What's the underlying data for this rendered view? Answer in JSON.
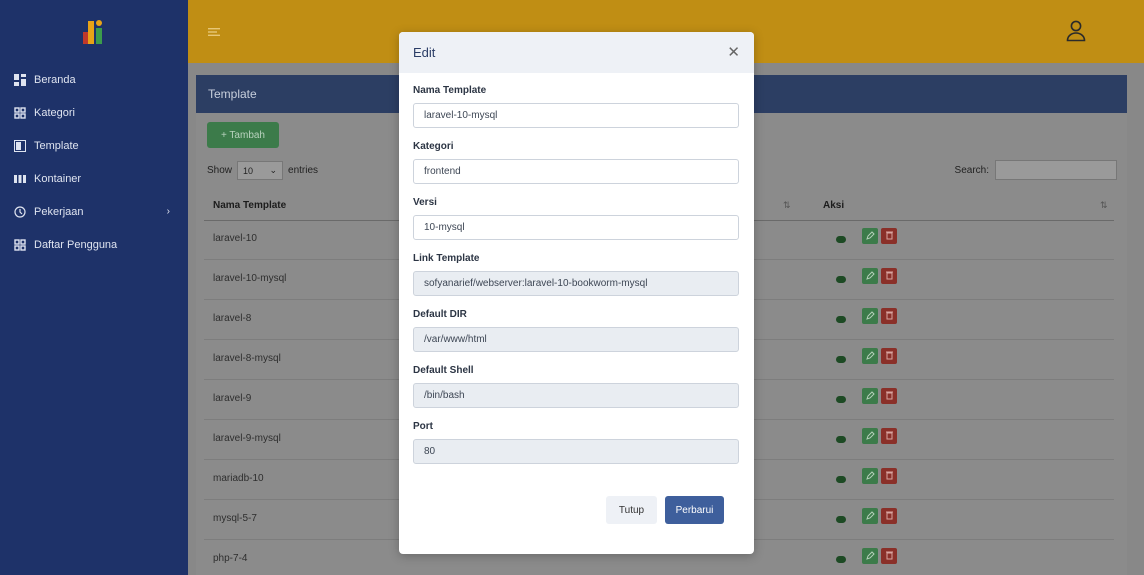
{
  "sidebar": {
    "items": [
      {
        "label": "Beranda"
      },
      {
        "label": "Kategori"
      },
      {
        "label": "Template"
      },
      {
        "label": "Kontainer"
      },
      {
        "label": "Pekerjaan"
      },
      {
        "label": "Daftar Pengguna"
      }
    ]
  },
  "panel": {
    "title": "Template",
    "add_label": "+ Tambah",
    "show_label": "Show",
    "entries_value": "10",
    "entries_label": "entries",
    "search_label": "Search:"
  },
  "table": {
    "headers": {
      "name": "Nama Template",
      "aksi": "Aksi"
    },
    "rows": [
      {
        "name": "laravel-10"
      },
      {
        "name": "laravel-10-mysql"
      },
      {
        "name": "laravel-8"
      },
      {
        "name": "laravel-8-mysql"
      },
      {
        "name": "laravel-9"
      },
      {
        "name": "laravel-9-mysql"
      },
      {
        "name": "mariadb-10"
      },
      {
        "name": "mysql-5-7"
      },
      {
        "name": "php-7-4"
      }
    ]
  },
  "modal": {
    "title": "Edit",
    "fields": {
      "nama_template": {
        "label": "Nama Template",
        "value": "laravel-10-mysql"
      },
      "kategori": {
        "label": "Kategori",
        "value": "frontend"
      },
      "versi": {
        "label": "Versi",
        "value": "10-mysql"
      },
      "link_template": {
        "label": "Link Template",
        "value": "sofyanarief/webserver:laravel-10-bookworm-mysql"
      },
      "default_dir": {
        "label": "Default DIR",
        "value": "/var/www/html"
      },
      "default_shell": {
        "label": "Default Shell",
        "value": "/bin/bash"
      },
      "port": {
        "label": "Port",
        "value": "80"
      }
    },
    "close_label": "Tutup",
    "submit_label": "Perbarui"
  },
  "colors": {
    "sidebar": "#1e3269",
    "topbar": "#c08e14",
    "primary": "#3e5f9c",
    "success": "#3c7b4a",
    "danger": "#8a3029"
  }
}
